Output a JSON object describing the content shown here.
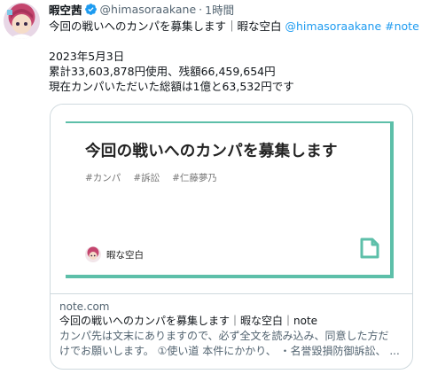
{
  "author": {
    "display_name": "暇空茜",
    "handle": "@himasoraakane",
    "separator": "·",
    "time": "1時間"
  },
  "tweet": {
    "line1_text": "今回の戦いへのカンパを募集します｜暇な空白",
    "line1_mention": "@himasoraakane",
    "line1_hashtag": "#note",
    "line2": "2023年5月3日",
    "line3": "累計33,603,878円使用、残額66,459,654円",
    "line4": "現在カンパいただいた総額は1億と63,532円です"
  },
  "card": {
    "image_title": "今回の戦いへのカンパを募集します",
    "tags": [
      "#カンパ",
      "#訴訟",
      "#仁藤夢乃"
    ],
    "image_author": "暇な空白",
    "domain": "note.com",
    "headline": "今回の戦いへのカンパを募集します｜暇な空白｜note",
    "desc_line1": "カンパ先は文末にありますので、必ず全文を読み込み、同意した方だ",
    "desc_line2": "けでお願いします。 ①使い道 本件にかかり、 ・名誉毀損防御訴訟、 ..."
  },
  "colors": {
    "link": "#1d9bf0",
    "note_accent": "#5dbfa9",
    "verified": "#1d9bf0"
  },
  "icons": {
    "verified": "verified-badge-icon",
    "note_logo": "note-document-icon"
  }
}
